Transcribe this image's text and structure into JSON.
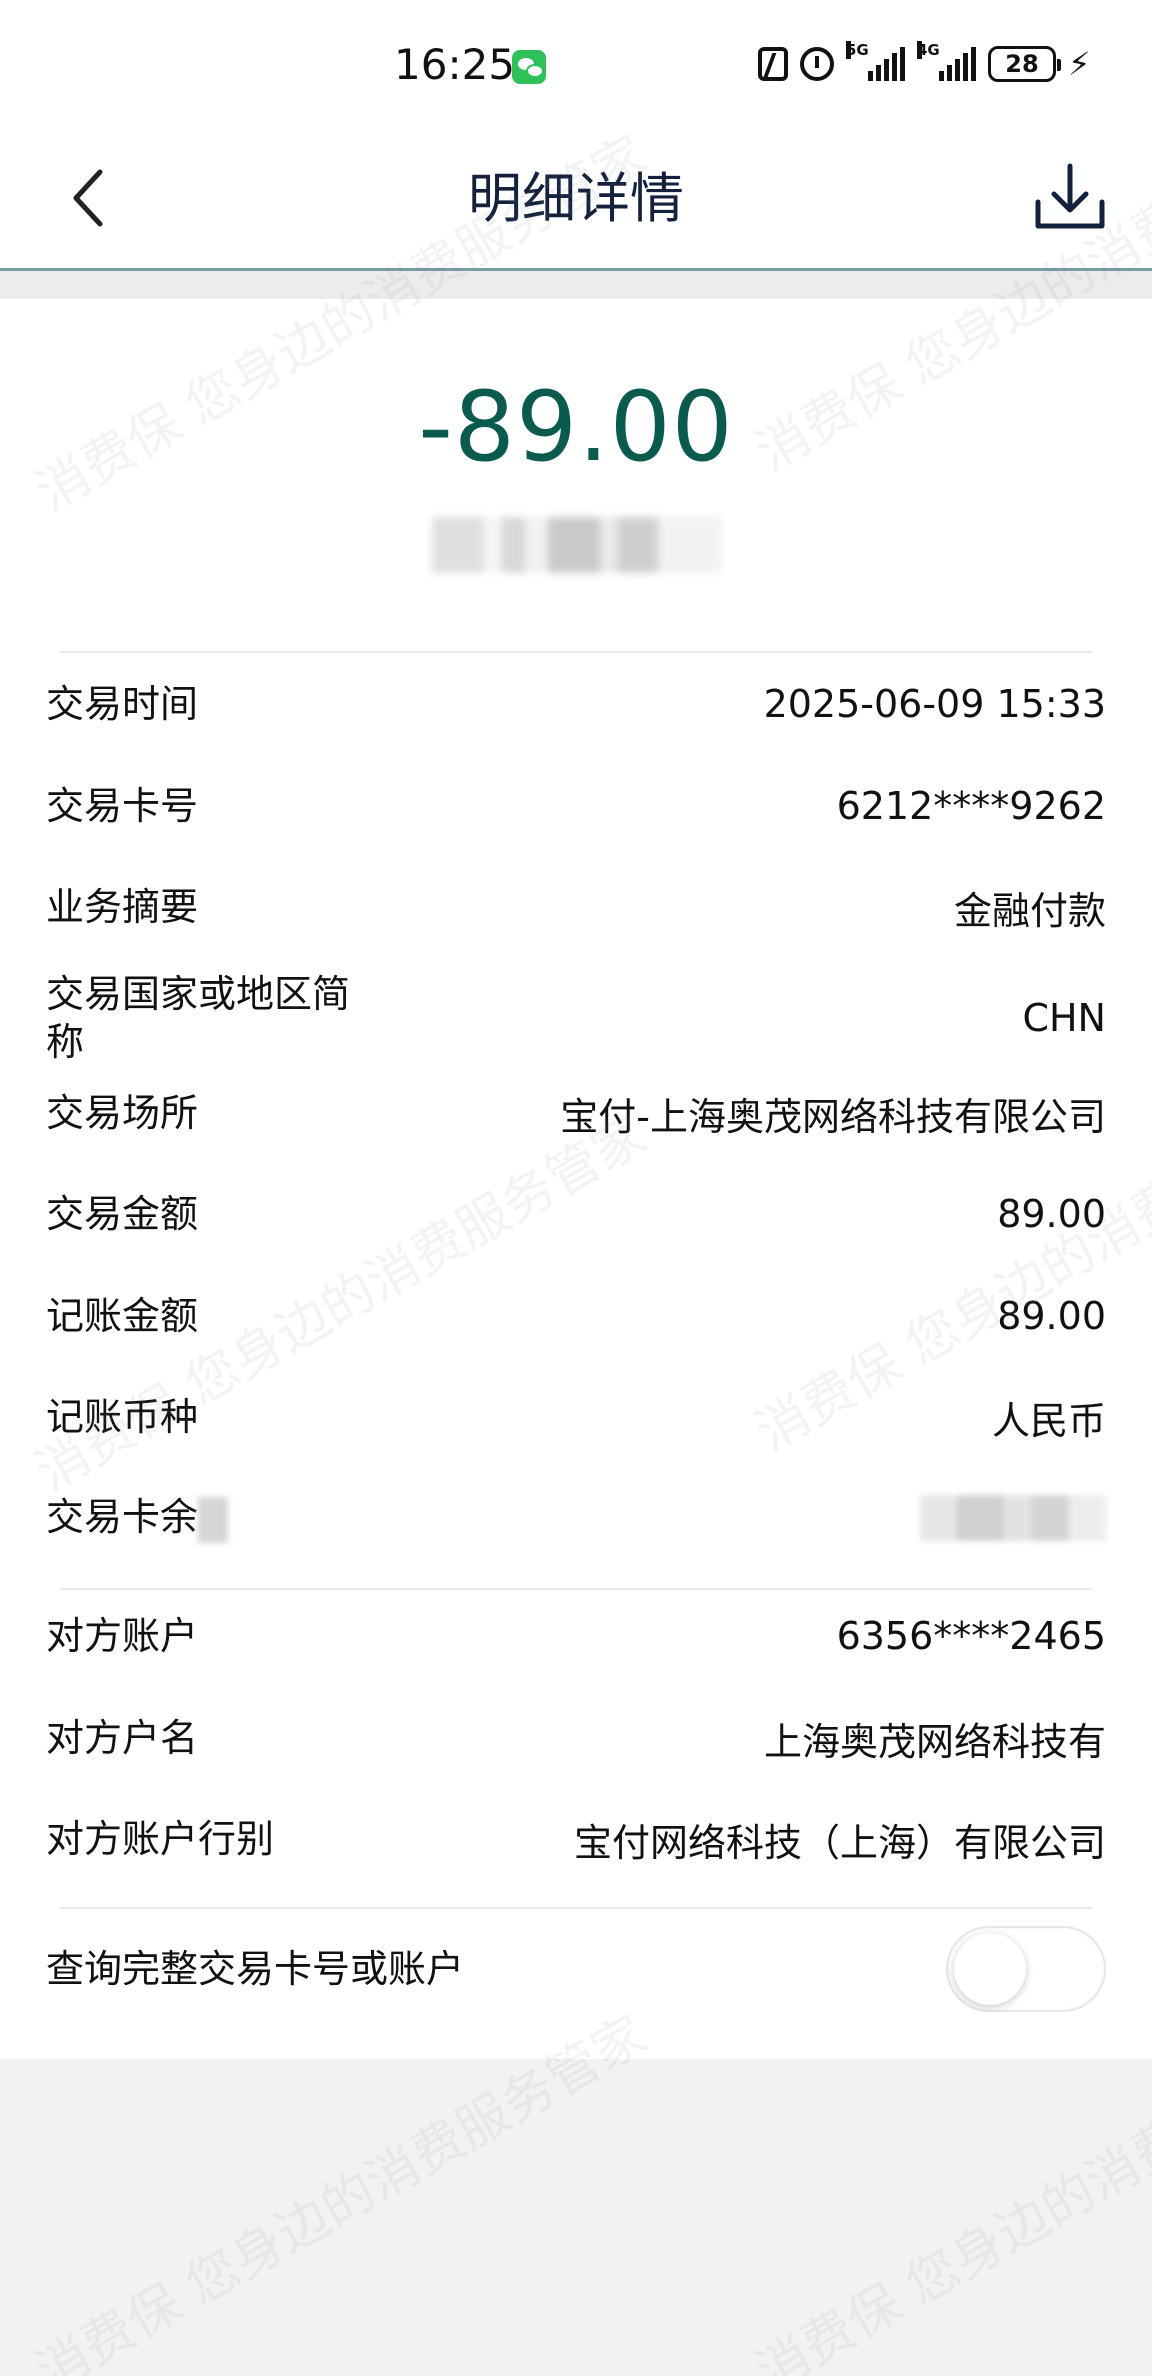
{
  "status_bar": {
    "time": "16:25",
    "sig1_label": "5G",
    "sig2_label": "4G",
    "battery": "28"
  },
  "header": {
    "title": "明细详情",
    "back_icon": "back-chevron-icon",
    "download_icon": "download-icon"
  },
  "summary": {
    "amount": "-89.00"
  },
  "details": [
    {
      "label": "交易时间",
      "value": "2025-06-09 15:33"
    },
    {
      "label": "交易卡号",
      "value": "6212****9262"
    },
    {
      "label": "业务摘要",
      "value": "金融付款"
    },
    {
      "label": "交易国家或地区简称",
      "value": "CHN"
    },
    {
      "label": "交易场所",
      "value": "宝付-上海奥茂网络科技有限公司"
    },
    {
      "label": "交易金额",
      "value": "89.00"
    },
    {
      "label": "记账金额",
      "value": "89.00"
    },
    {
      "label": "记账币种",
      "value": "人民币"
    },
    {
      "label": "交易卡余",
      "value": ""
    }
  ],
  "counterparty": [
    {
      "label": "对方账户",
      "value": "6356****2465"
    },
    {
      "label": "对方户名",
      "value": "上海奥茂网络科技有"
    },
    {
      "label": "对方账户行别",
      "value": "宝付网络科技（上海）有限公司"
    }
  ],
  "toggle_row": {
    "label": "查询完整交易卡号或账户",
    "enabled": false
  },
  "watermark": {
    "text": "消费保 您身边的消费服务管家"
  },
  "colors": {
    "amount": "#0a5a4e",
    "title": "#14213d",
    "nav_border": "#7b9aa6"
  }
}
